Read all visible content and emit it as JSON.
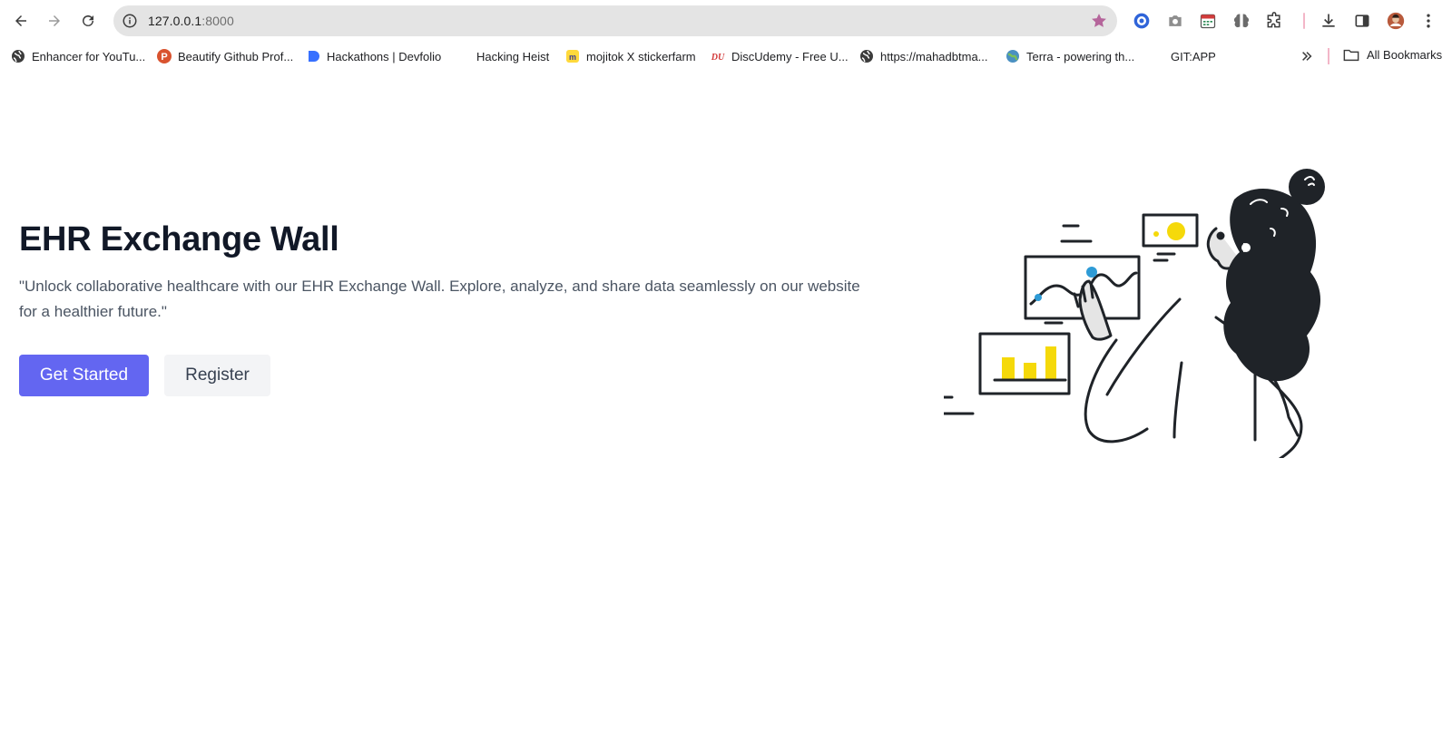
{
  "browser": {
    "url_host": "127.0.0.1",
    "url_port": ":8000",
    "accent_color": "#b5659b",
    "bookmarks": [
      {
        "label": "Enhancer for YouTu...",
        "icon": "globe-icon"
      },
      {
        "label": "Beautify Github Prof...",
        "icon": "p-badge-icon"
      },
      {
        "label": "Hackathons | Devfolio",
        "icon": "devfolio-icon"
      },
      {
        "label": "Hacking Heist",
        "icon": "blank-icon"
      },
      {
        "label": "mojitok X stickerfarm",
        "icon": "mojitok-icon"
      },
      {
        "label": "DiscUdemy - Free U...",
        "icon": "discudemy-icon"
      },
      {
        "label": "https://mahadbtma...",
        "icon": "globe-icon"
      },
      {
        "label": "Terra - powering th...",
        "icon": "terra-icon"
      },
      {
        "label": "GIT:APP",
        "icon": "blank-icon"
      }
    ],
    "all_bookmarks_label": "All Bookmarks"
  },
  "hero": {
    "title": "EHR Exchange Wall",
    "description": "\"Unlock collaborative healthcare with our EHR Exchange Wall. Explore, analyze, and share data seamlessly on our website for a healthier future.\"",
    "primary_button": "Get Started",
    "secondary_button": "Register",
    "primary_color": "#6366f1"
  }
}
